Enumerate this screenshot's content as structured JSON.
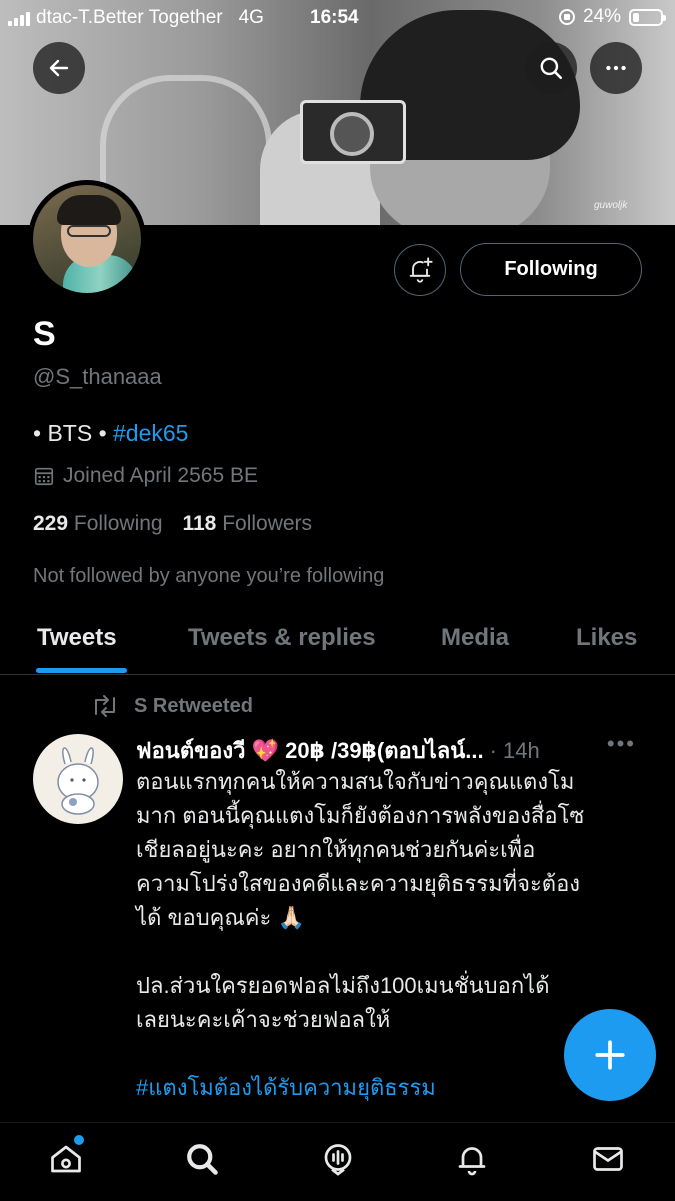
{
  "status_bar": {
    "carrier": "dtac-T.Better Together",
    "network": "4G",
    "time": "16:54",
    "battery": "24%",
    "battery_level": 0.24
  },
  "banner": {
    "watermark": "guwoljk"
  },
  "profile": {
    "name": "S",
    "handle": "@S_thanaaa",
    "bio_prefix": "• BTS •",
    "bio_hashtag": "#dek65",
    "joined": "Joined April 2565 BE",
    "following_count": "229",
    "following_label": "Following",
    "followers_count": "118",
    "followers_label": "Followers",
    "not_followed": "Not followed by anyone you’re following",
    "follow_button": "Following"
  },
  "tabs": [
    {
      "label": "Tweets",
      "active": true
    },
    {
      "label": "Tweets & replies",
      "active": false
    },
    {
      "label": "Media",
      "active": false
    },
    {
      "label": "Likes",
      "active": false
    }
  ],
  "tweet": {
    "retweet_label": "S Retweeted",
    "author": "ฟอนต์ของวี 💖 20฿ /39฿(ตอบไลน์...",
    "time": "· 14h",
    "lines": [
      "ตอนแรกทุกคนให้ความสนใจกับข่าวคุณแตงโม",
      "มาก ตอนนี้คุณแตงโมก็ยังต้องการพลังของสื่อโซ",
      "เชียลอยู่นะคะ อยากให้ทุกคนช่วยกันค่ะเพื่อ",
      "ความโปร่งใสของคดีและความยุติธรรมที่จะต้อง",
      "ได้ ขอบคุณค่ะ 🙏🏻"
    ],
    "lines2": [
      "ปล.ส่วนใครยอดฟอลไม่ถึง100เมนชั่นบอกได้",
      "เลยนะคะเค้าจะช่วยฟอลให้"
    ],
    "hashtag": "#แตงโมต้องได้รับความยุติธรรม"
  },
  "colors": {
    "accent": "#1d9bf0",
    "background": "#000000",
    "muted": "#71767b"
  },
  "icons": [
    "back-arrow-icon",
    "search-icon",
    "more-icon",
    "bell-plus-icon",
    "calendar-icon",
    "retweet-icon",
    "compose-plus-icon",
    "home-icon",
    "spaces-icon",
    "notifications-icon",
    "messages-icon"
  ]
}
